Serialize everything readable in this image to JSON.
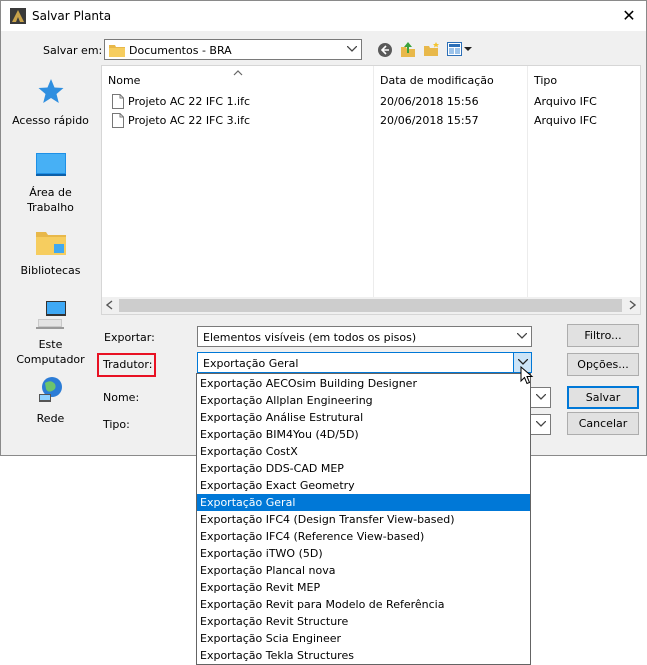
{
  "window": {
    "title": "Salvar Planta",
    "close_glyph": "✕"
  },
  "location": {
    "label": "Salvar em:",
    "value": "Documentos - BRA"
  },
  "toolbar_icons": [
    "back-icon",
    "up-folder-icon",
    "new-folder-icon",
    "view-menu-icon"
  ],
  "places": [
    {
      "label": "Acesso rápido",
      "icon": "star-icon"
    },
    {
      "label": "Área de Trabalho",
      "icon": "desktop-icon"
    },
    {
      "label": "Bibliotecas",
      "icon": "libraries-icon"
    },
    {
      "label": "Este Computador",
      "icon": "computer-icon"
    },
    {
      "label": "Rede",
      "icon": "network-icon"
    }
  ],
  "file_list": {
    "columns": [
      "Nome",
      "Data de modificação",
      "Tipo"
    ],
    "rows": [
      {
        "name": "Projeto AC 22 IFC 1.ifc",
        "date": "20/06/2018 15:56",
        "type": "Arquivo IFC"
      },
      {
        "name": "Projeto AC 22 IFC 3.ifc",
        "date": "20/06/2018 15:57",
        "type": "Arquivo IFC"
      }
    ]
  },
  "form": {
    "export_label": "Exportar:",
    "export_value": "Elementos visíveis (em todos os pisos)",
    "translator_label": "Tradutor:",
    "translator_value": "Exportação Geral",
    "name_label": "Nome:",
    "type_label": "Tipo:"
  },
  "buttons": {
    "filter": "Filtro...",
    "options": "Opções...",
    "save": "Salvar",
    "cancel": "Cancelar"
  },
  "translator_options": [
    "Exportação AECOsim Building Designer",
    "Exportação Allplan Engineering",
    "Exportação Análise Estrutural",
    "Exportação BIM4You (4D/5D)",
    "Exportação CostX",
    "Exportação DDS-CAD MEP",
    "Exportação Exact Geometry",
    "Exportação Geral",
    "Exportação IFC4 (Design Transfer View-based)",
    "Exportação IFC4 (Reference View-based)",
    "Exportação iTWO (5D)",
    "Exportação Plancal nova",
    "Exportação Revit MEP",
    "Exportação Revit para Modelo de Referência",
    "Exportação Revit Structure",
    "Exportação Scia Engineer",
    "Exportação Tekla Structures"
  ],
  "selected_option_index": 7,
  "colors": {
    "accent": "#0078d7",
    "highlight_border": "#e81123"
  }
}
